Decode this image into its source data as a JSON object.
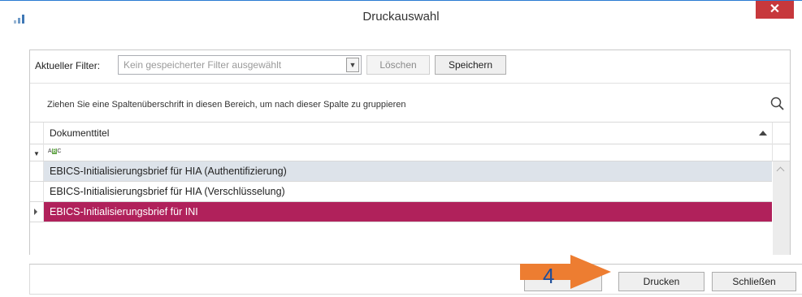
{
  "window": {
    "title": "Druckauswahl",
    "close_label": "✕"
  },
  "filter": {
    "label": "Aktueller Filter:",
    "placeholder": "Kein gespeicherter Filter ausgewählt",
    "clear_label": "Löschen",
    "save_label": "Speichern"
  },
  "grouping": {
    "hint": "Ziehen Sie eine Spaltenüberschrift in diesen Bereich, um nach dieser Spalte zu gruppieren"
  },
  "grid": {
    "column_header": "Dokumenttitel",
    "rows": [
      {
        "title": "EBICS-Initialisierungsbrief für HIA (Authentifizierung)"
      },
      {
        "title": "EBICS-Initialisierungsbrief für HIA (Verschlüsselung)"
      },
      {
        "title": "EBICS-Initialisierungsbrief für INI"
      }
    ]
  },
  "footer": {
    "print_label": "Drucken",
    "close_label": "Schließen"
  },
  "callout": {
    "number": "4"
  },
  "colors": {
    "selected_row": "#b0215b",
    "callout_arrow": "#ed7d31",
    "close_button": "#c7383c"
  }
}
